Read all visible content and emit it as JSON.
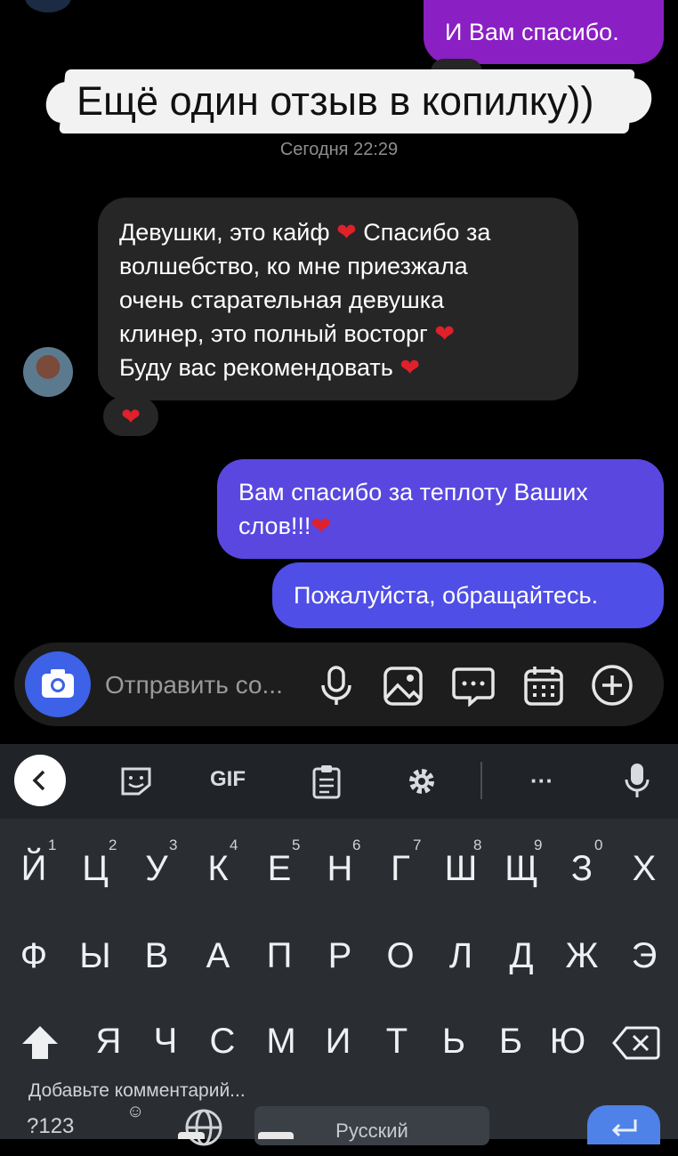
{
  "messages": {
    "top_out": "И Вам спасибо.",
    "banner": "Ещё один отзыв в копилку))",
    "timestamp": "Сегодня 22:29",
    "incoming": {
      "line1": "Девушки, это кайф",
      "line1b": "Спасибо за",
      "line2": "волшебство, ко мне приезжала",
      "line3": "очень старательная девушка",
      "line4": "клинер, это полный восторг",
      "line5": "Буду вас рекомендовать"
    },
    "out2": {
      "line1": "Вам спасибо за теплоту Ваших",
      "line2": "слов!!!"
    },
    "out3": "Пожалуйста, обращайтесь."
  },
  "composer": {
    "placeholder": "Отправить со..."
  },
  "keyboard": {
    "toolbar": {
      "gif": "GIF",
      "more": "···"
    },
    "row1": [
      "Й",
      "Ц",
      "У",
      "К",
      "Е",
      "Н",
      "Г",
      "Ш",
      "Щ",
      "З",
      "Х"
    ],
    "row1_nums": [
      "1",
      "2",
      "3",
      "4",
      "5",
      "6",
      "7",
      "8",
      "9",
      "0"
    ],
    "row2": [
      "Ф",
      "Ы",
      "В",
      "А",
      "П",
      "Р",
      "О",
      "Л",
      "Д",
      "Ж",
      "Э"
    ],
    "row3": [
      "Я",
      "Ч",
      "С",
      "М",
      "И",
      "Т",
      "Ь",
      "Б",
      "Ю"
    ],
    "comment_hint": "Добавьте комментарий...",
    "symbols": "?123",
    "space": "Русский"
  },
  "colors": {
    "accent_purple": "#8a1fc4",
    "accent_blue": "#5947e0",
    "heart": "#e0202a",
    "camera": "#3d62e8"
  },
  "icons": [
    "camera-icon",
    "mic-icon",
    "image-icon",
    "sticker-chat-icon",
    "calendar-icon",
    "plus-icon",
    "back-icon",
    "emoji-sticker-icon",
    "clipboard-icon",
    "gear-icon",
    "keyboard-mic-icon",
    "shift-icon",
    "backspace-icon",
    "globe-icon",
    "enter-icon",
    "heart-icon"
  ]
}
